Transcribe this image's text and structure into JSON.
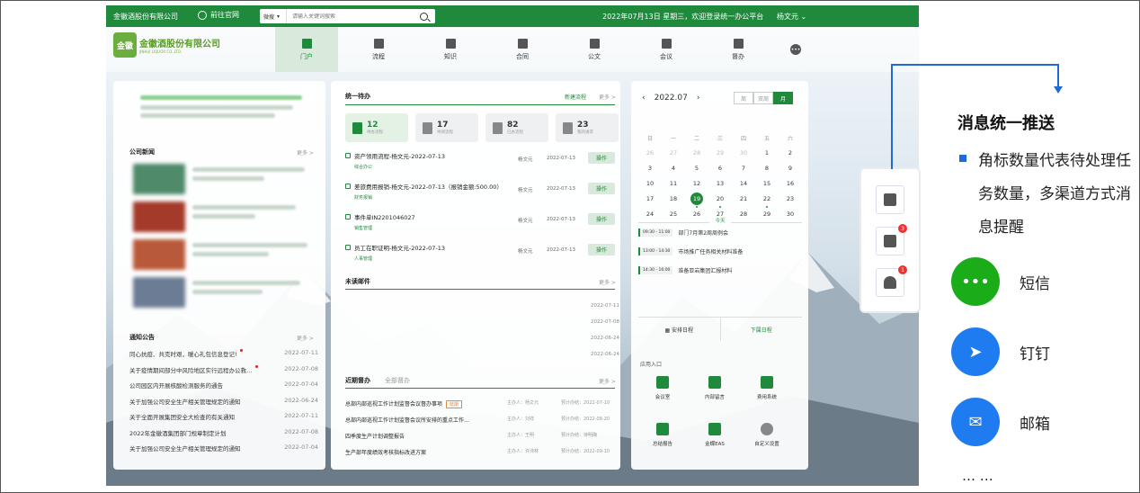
{
  "topbar": {
    "company": "金徽酒股份有限公司",
    "official_site": "前往官网",
    "search_scope": "微搜",
    "search_placeholder": "请输入关键词搜索",
    "date_greeting": "2022年07月13日 星期三，欢迎登录统一办公平台",
    "user": "杨文元"
  },
  "logo": {
    "mark": "金徽",
    "name": "金徽酒股份有限公司",
    "en": "JINHUI LIQUOR CO.,LTD."
  },
  "nav": [
    {
      "label": "门户",
      "icon": "home-icon",
      "active": true
    },
    {
      "label": "流程",
      "icon": "flow-icon"
    },
    {
      "label": "知识",
      "icon": "book-icon"
    },
    {
      "label": "合同",
      "icon": "contract-icon"
    },
    {
      "label": "公文",
      "icon": "document-icon"
    },
    {
      "label": "会议",
      "icon": "meeting-icon"
    },
    {
      "label": "督办",
      "icon": "supervise-icon"
    }
  ],
  "news": {
    "title": "公司新闻",
    "more": "更多 >"
  },
  "notices": {
    "title": "通知公告",
    "more": "更多 >",
    "items": [
      {
        "text": "同心抗疫、共克时艰，暖心礼包信息登记!",
        "date": "2022-07-11",
        "hot": true
      },
      {
        "text": "关于疫情期间部分中风险地区实行远程办公救…",
        "date": "2022-07-08",
        "hot": true
      },
      {
        "text": "公司园区内开展核酸检测服务的通告",
        "date": "2022-07-04"
      },
      {
        "text": "关于加强公司安全生产相关管理规定的通知",
        "date": "2022-06-24"
      },
      {
        "text": "关于全面开展集团安全大检查的有关通知",
        "date": "2022-07-11"
      },
      {
        "text": "2022年金徽酒集团部门规章制定计划",
        "date": "2022-07-08"
      },
      {
        "text": "关于加强公司安全生产相关管理规定的通知",
        "date": "2022-07-04"
      }
    ]
  },
  "todo": {
    "title": "统一待办",
    "new_flow": "新建流程",
    "more": "更多 >",
    "counters": [
      {
        "n": "12",
        "t": "待办流程"
      },
      {
        "n": "17",
        "t": "待阅流程"
      },
      {
        "n": "82",
        "t": "已办流程"
      },
      {
        "n": "23",
        "t": "我的请求"
      }
    ],
    "items": [
      {
        "title": "资产领用流程-杨文元-2022-07-13",
        "dept": "综合办公",
        "who": "杨文元",
        "date": "2022-07-13",
        "op": "操作"
      },
      {
        "title": "差旅费用报销-杨文元-2022-07-13（报销金额:500.00）",
        "dept": "财务报销",
        "who": "杨文元",
        "date": "2022-07-13",
        "op": "操作"
      },
      {
        "title": "事件单IN2201046027",
        "dept": "销售管理",
        "who": "杨文元",
        "date": "2022-07-13",
        "op": "操作"
      },
      {
        "title": "员工在职证明-杨文元-2022-07-13",
        "dept": "人事管理",
        "who": "杨文元",
        "date": "2022-07-13",
        "op": "操作"
      }
    ]
  },
  "mail": {
    "title": "未读邮件",
    "more": "更多 >",
    "dates": [
      "2022-07-11",
      "2022-07-08",
      "2022-06-24",
      "2022-06-24"
    ]
  },
  "supervise": {
    "tab_recent": "近期督办",
    "tab_all": "全部督办",
    "more": "更多 >",
    "items": [
      {
        "title": "总部内部巡视工作计划监督会议督办事项",
        "tag": "延期",
        "owner": "主办人：杨文元",
        "due": "预计办结：2022-07-10"
      },
      {
        "title": "总部内部巡视工作计划监督会议所安排的重点工作…",
        "owner": "主办人：刘祥",
        "due": "预计办结：2022-08-20"
      },
      {
        "title": "四季度生产计划调整报告",
        "owner": "主办人：王明",
        "due": "预计办结：待明确"
      },
      {
        "title": "生产部年度绩效考核指标改进方案",
        "owner": "主办人：许沛林",
        "due": "预计办结：2022-09-10"
      }
    ]
  },
  "calendar": {
    "month": "2022.07",
    "views": [
      "周",
      "双周",
      "月"
    ],
    "weekdays": [
      "日",
      "一",
      "二",
      "三",
      "四",
      "五",
      "六"
    ],
    "days": [
      "26",
      "27",
      "28",
      "29",
      "30",
      "1",
      "2",
      "3",
      "4",
      "5",
      "6",
      "7",
      "8",
      "9",
      "10",
      "11",
      "12",
      "13",
      "14",
      "15",
      "16",
      "17",
      "18",
      "19",
      "20",
      "21",
      "22",
      "23",
      "24",
      "25",
      "26",
      "27",
      "28",
      "29",
      "30"
    ],
    "today_label": "今天",
    "events": [
      {
        "time": "09:30 - 11:00",
        "title": "部门7月第2周周例会"
      },
      {
        "time": "13:00 - 14:30",
        "title": "市场推广任务相关材料准备"
      },
      {
        "time": "14:30 - 16:00",
        "title": "准备亚岩集团汇报材料"
      }
    ],
    "btn_arrange": "安排日程",
    "btn_download": "下属日程"
  },
  "apps": {
    "title": "应用入口",
    "items": [
      "会议室",
      "内部留言",
      "费用系统",
      "总结报告",
      "金蝶EAS",
      "自定义设置"
    ]
  },
  "notif_badges": {
    "mail": "3",
    "bell": "1"
  },
  "annotation": {
    "title": "消息统一推送",
    "desc": "角标数量代表待处理任务数量，多渠道方式消息提醒",
    "channels": [
      {
        "label": "短信",
        "color": "#1aad19"
      },
      {
        "label": "钉钉",
        "color": "#1e7bf0"
      },
      {
        "label": "邮箱",
        "color": "#1e7bf0"
      }
    ],
    "ellipsis": "… …"
  }
}
